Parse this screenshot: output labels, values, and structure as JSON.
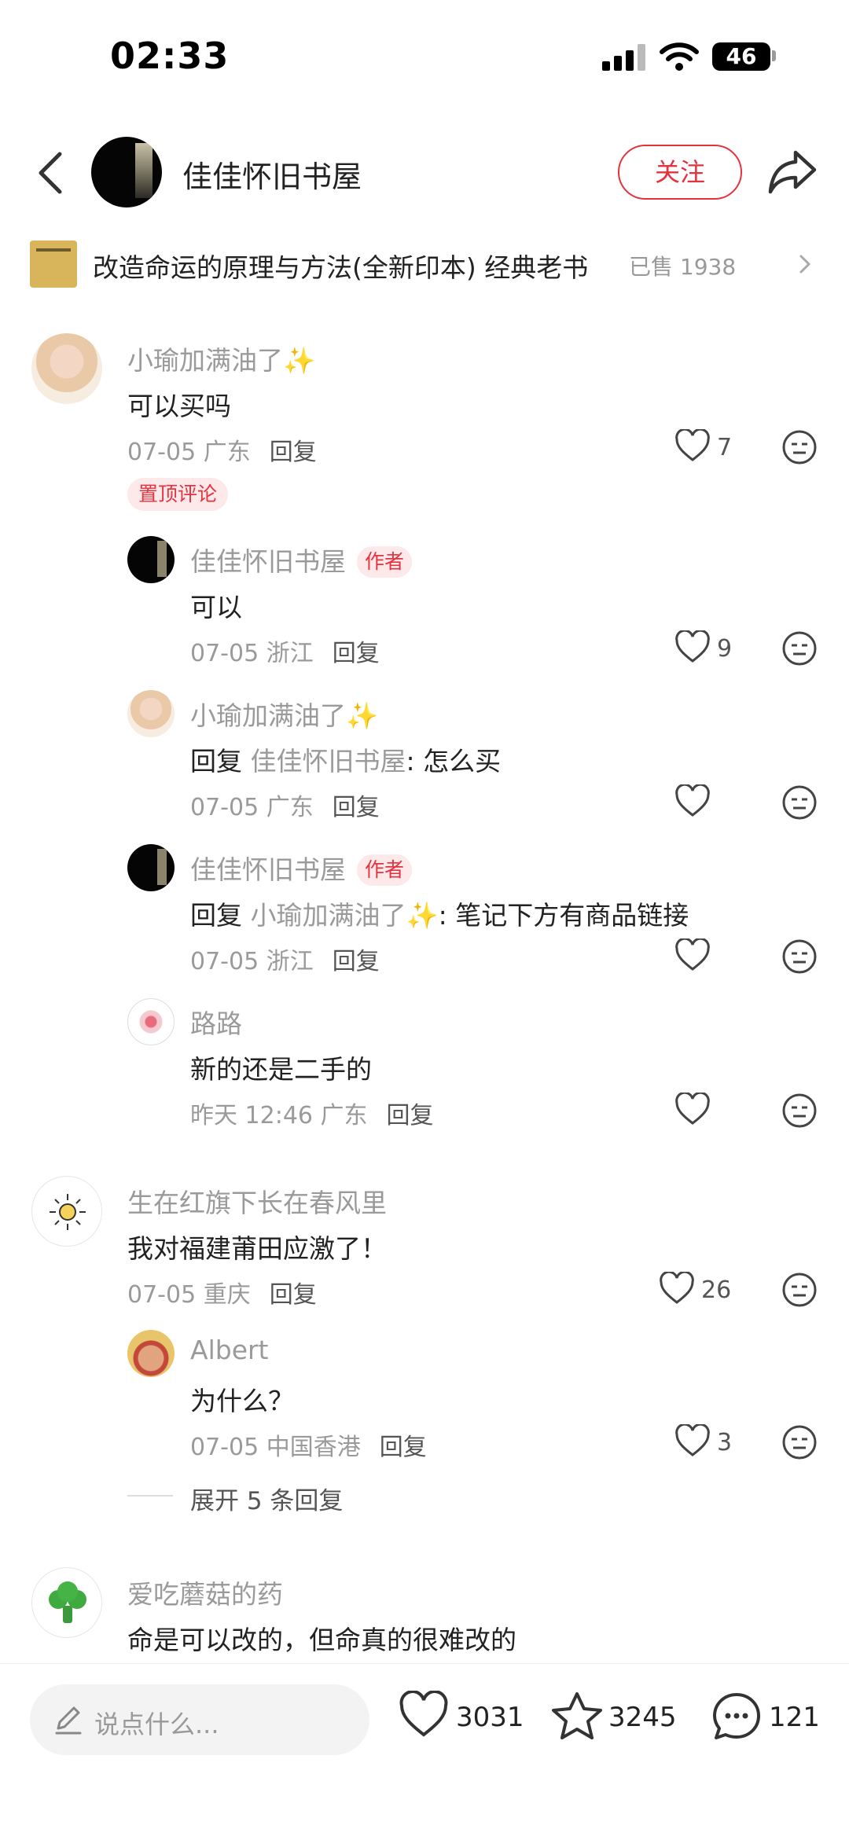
{
  "status_bar": {
    "time": "02:33",
    "battery": "46"
  },
  "header": {
    "shop_name": "佳佳怀旧书屋",
    "follow_label": "关注"
  },
  "product": {
    "title": "改造命运的原理与方法(全新印本) 经典老书",
    "sold": "已售 1938"
  },
  "comments": [
    {
      "user": "小瑜加满油了✨",
      "text": "可以买吗",
      "date": "07-05 广东",
      "reply": "回复",
      "likes": "7",
      "pinned": "置顶评论"
    },
    {
      "user": "佳佳怀旧书屋",
      "tag": "作者",
      "text": "可以",
      "date": "07-05 浙江",
      "reply": "回复",
      "likes": "9"
    },
    {
      "user": "小瑜加满油了✨",
      "text_prefix": "回复 ",
      "ref": "佳佳怀旧书屋",
      "text": ": 怎么买",
      "date": "07-05 广东",
      "reply": "回复"
    },
    {
      "user": "佳佳怀旧书屋",
      "tag": "作者",
      "text_prefix": "回复 ",
      "ref": "小瑜加满油了✨",
      "text": ": 笔记下方有商品链接",
      "date": "07-05 浙江",
      "reply": "回复"
    },
    {
      "user": "路路",
      "text": "新的还是二手的",
      "date": "昨天 12:46 广东",
      "reply": "回复"
    },
    {
      "user": "生在红旗下长在春风里",
      "text": "我对福建莆田应激了！",
      "date": "07-05 重庆",
      "reply": "回复",
      "likes": "26"
    },
    {
      "user": "Albert",
      "text": "为什么？",
      "date": "07-05 中国香港",
      "reply": "回复",
      "likes": "3"
    },
    {
      "user": "爱吃蘑菇的药",
      "text": "命是可以改的，但命真的很难改的"
    }
  ],
  "expand_replies": "展开 5 条回复",
  "bottom_bar": {
    "input_placeholder": "说点什么...",
    "likes": "3031",
    "stars": "3245",
    "comments": "121"
  },
  "colors": {
    "accent": "#e4323f",
    "muted": "#9a9a9a",
    "tag_bg": "#fde8ea"
  }
}
